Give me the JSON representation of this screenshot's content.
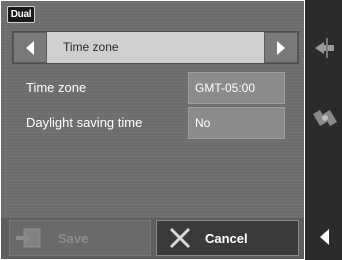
{
  "brand": {
    "logo_text": "Dual"
  },
  "nav": {
    "title": "Time zone",
    "prev_icon": "chevron-left-icon",
    "next_icon": "chevron-right-icon"
  },
  "settings": [
    {
      "label": "Time zone",
      "value": "GMT-05:00"
    },
    {
      "label": "Daylight saving time",
      "value": "No"
    }
  ],
  "footer": {
    "save_label": "Save",
    "cancel_label": "Cancel",
    "save_enabled": false
  },
  "side_panel": {
    "icons": [
      "route-sign-icon",
      "satellite-icon",
      "back-arrow-icon"
    ]
  },
  "colors": {
    "background": "#6d6d6d",
    "nav_bar": "#cfcfcf",
    "value_field": "#8b8b8b",
    "side_panel": "#2b2b2b"
  }
}
